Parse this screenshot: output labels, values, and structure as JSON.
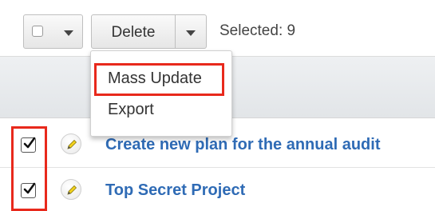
{
  "toolbar": {
    "delete_label": "Delete",
    "selected_label": "Selected:",
    "selected_count": "9"
  },
  "dropdown": {
    "items": [
      {
        "label": "Mass Update"
      },
      {
        "label": "Export"
      }
    ]
  },
  "rows": [
    {
      "checked": true,
      "name": "Create new plan for the annual audit"
    },
    {
      "checked": true,
      "name": "Top Secret Project"
    }
  ],
  "colors": {
    "link": "#2f6bb5",
    "highlight": "#e8291c"
  }
}
